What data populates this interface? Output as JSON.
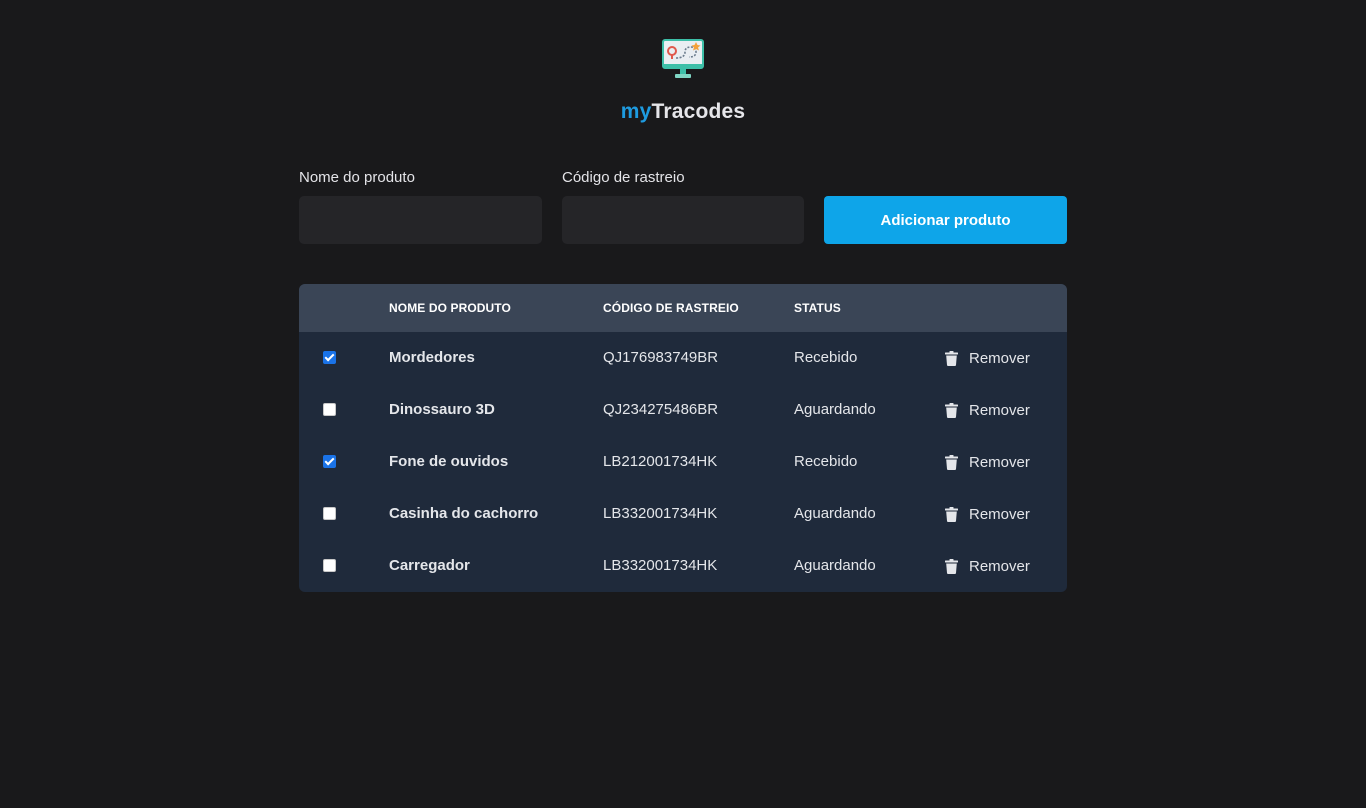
{
  "brand": {
    "prefix": "my",
    "suffix": "Tracodes",
    "prefix_color": "#1e9be0",
    "logo_icon": "monitor-route-icon"
  },
  "form": {
    "product_label": "Nome do produto",
    "product_value": "",
    "tracking_label": "Código de rastreio",
    "tracking_value": "",
    "add_button": "Adicionar produto",
    "button_color": "#0ea5e9"
  },
  "table": {
    "headers": {
      "name": "NOME DO PRODUTO",
      "code": "CÓDIGO DE RASTREIO",
      "status": "STATUS"
    },
    "remove_icon": "trash-icon",
    "rows": [
      {
        "checked": true,
        "name": "Mordedores",
        "code": "QJ176983749BR",
        "status": "Recebido",
        "action": "Remover"
      },
      {
        "checked": false,
        "name": "Dinossauro 3D",
        "code": "QJ234275486BR",
        "status": "Aguardando",
        "action": "Remover"
      },
      {
        "checked": true,
        "name": "Fone de ouvidos",
        "code": "LB212001734HK",
        "status": "Recebido",
        "action": "Remover"
      },
      {
        "checked": false,
        "name": "Casinha do cachorro",
        "code": "LB332001734HK",
        "status": "Aguardando",
        "action": "Remover"
      },
      {
        "checked": false,
        "name": "Carregador",
        "code": "LB332001734HK",
        "status": "Aguardando",
        "action": "Remover"
      }
    ]
  }
}
